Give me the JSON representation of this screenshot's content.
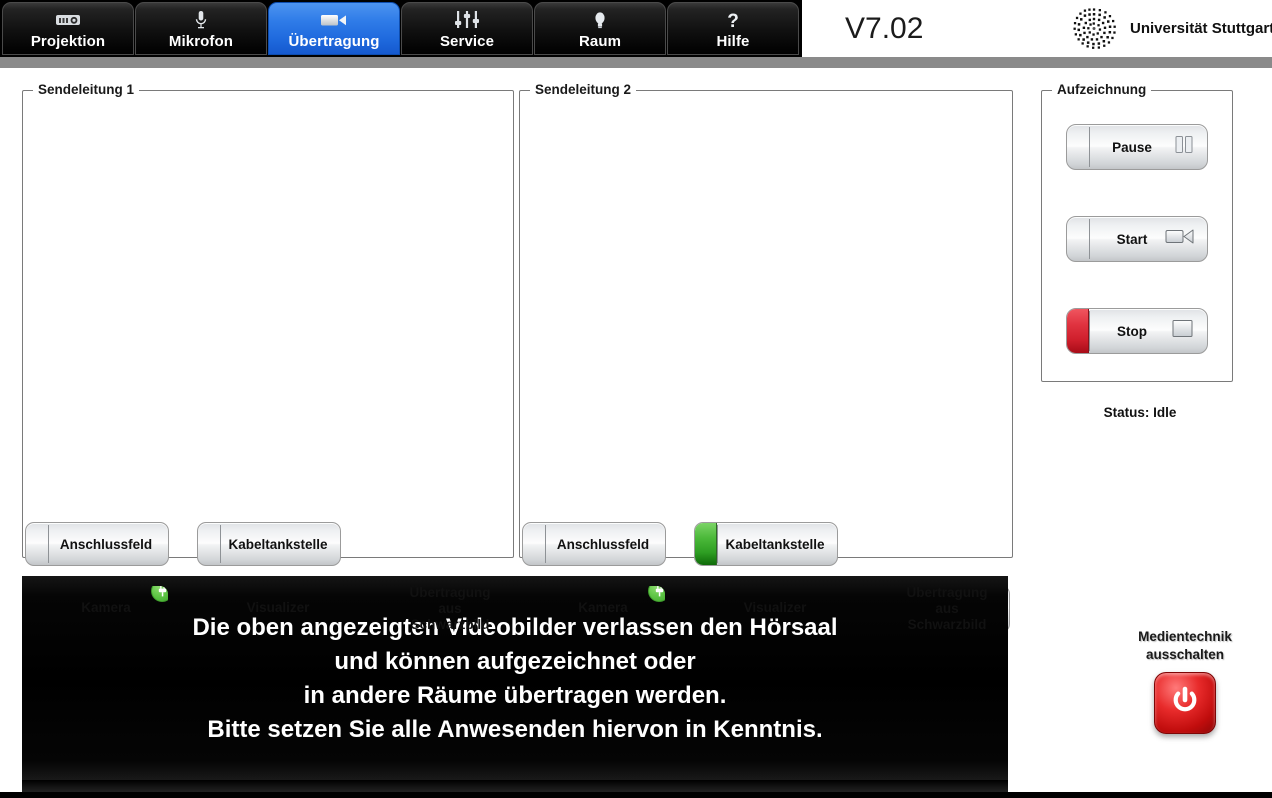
{
  "header": {
    "version": "V7.02",
    "brand_name": "Universität Stuttgart",
    "logo_icon": "university-dot-logo"
  },
  "tabs": [
    {
      "label": "Projektion",
      "icon": "projector-icon",
      "active": false
    },
    {
      "label": "Mikrofon",
      "icon": "microphone-icon",
      "active": false
    },
    {
      "label": "Übertragung",
      "icon": "camcorder-icon",
      "active": true
    },
    {
      "label": "Service",
      "icon": "faders-icon",
      "active": false
    },
    {
      "label": "Raum",
      "icon": "lightbulb-icon",
      "active": false
    },
    {
      "label": "Hilfe",
      "icon": "question-icon",
      "active": false
    }
  ],
  "line1": {
    "legend": "Sendeleitung 1",
    "buttons": [
      {
        "label": "Anschlussfeld",
        "state": "off",
        "badge": null
      },
      {
        "label": "Kabeltankstelle",
        "state": "off",
        "badge": null
      },
      {
        "label": "Kamera",
        "state": "active",
        "badge": "plug-icon"
      },
      {
        "label": "Visualizer",
        "state": "off",
        "badge": null
      },
      {
        "label": "Übertragung\naus\nSchwarzbild",
        "state": "off",
        "badge": null
      }
    ]
  },
  "line2": {
    "legend": "Sendeleitung 2",
    "buttons": [
      {
        "label": "Anschlussfeld",
        "state": "off",
        "badge": null
      },
      {
        "label": "Kabeltankstelle",
        "state": "active",
        "badge": null
      },
      {
        "label": "Kamera",
        "state": "off",
        "badge": "plug-icon"
      },
      {
        "label": "Visualizer",
        "state": "off",
        "badge": null
      },
      {
        "label": "Übertragung\naus\nSchwarzbild",
        "state": "off",
        "badge": null
      }
    ]
  },
  "recording": {
    "legend": "Aufzeichnung",
    "buttons": [
      {
        "label": "Pause",
        "icon": "pause-bars-icon",
        "strip": "none"
      },
      {
        "label": "Start",
        "icon": "camcorder-icon",
        "strip": "none"
      },
      {
        "label": "Stop",
        "icon": "stop-square-icon",
        "strip": "red"
      }
    ],
    "status": "Status: Idle"
  },
  "notice": {
    "lines": [
      "Die oben angezeigten Videobilder verlassen den Hörsaal",
      "und können aufgezeichnet oder",
      "in andere Räume übertragen werden.",
      "Bitte setzen Sie alle Anwesenden hiervon in Kenntnis."
    ]
  },
  "power": {
    "label_line1": "Medientechnik",
    "label_line2": "ausschalten",
    "icon": "power-icon"
  },
  "colors": {
    "active_tab": "#2f7ce8",
    "green_active": "#3da82c",
    "red_stop": "#cf1f2c",
    "power_red": "#e82b2b",
    "graybar": "#8a8a8a"
  }
}
